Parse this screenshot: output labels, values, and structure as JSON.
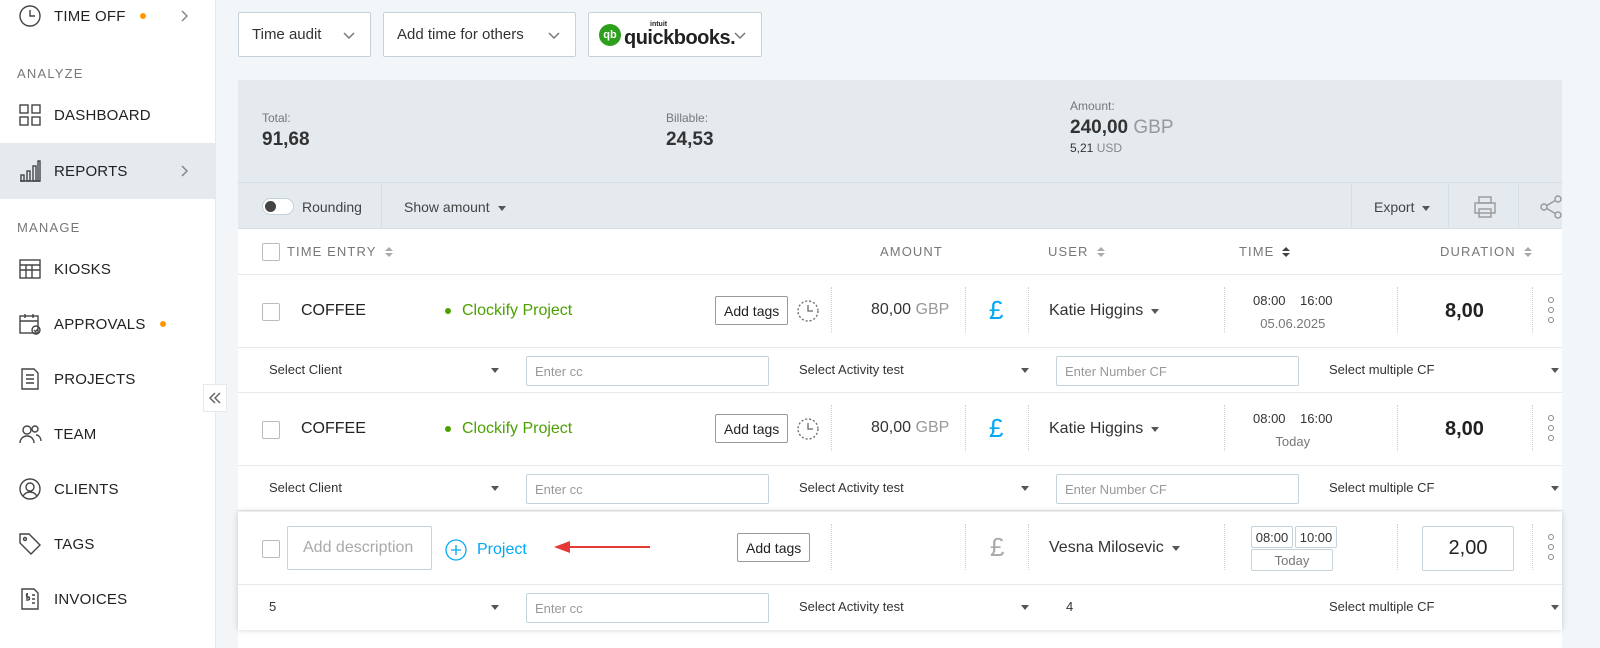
{
  "sidebar": {
    "items_top": [
      {
        "label": "TIME OFF",
        "icon": "clock-icon",
        "dot": true,
        "chevron": true
      }
    ],
    "section_analyze": "ANALYZE",
    "items_analyze": [
      {
        "label": "DASHBOARD",
        "icon": "dashboard-icon"
      },
      {
        "label": "REPORTS",
        "icon": "reports-icon",
        "chevron": true,
        "active": true
      }
    ],
    "section_manage": "MANAGE",
    "items_manage": [
      {
        "label": "KIOSKS",
        "icon": "kiosk-icon"
      },
      {
        "label": "APPROVALS",
        "icon": "approvals-icon",
        "dot": true
      },
      {
        "label": "PROJECTS",
        "icon": "projects-icon"
      },
      {
        "label": "TEAM",
        "icon": "team-icon"
      },
      {
        "label": "CLIENTS",
        "icon": "clients-icon"
      },
      {
        "label": "TAGS",
        "icon": "tag-icon"
      },
      {
        "label": "INVOICES",
        "icon": "invoice-icon"
      }
    ]
  },
  "top": {
    "time_audit": "Time audit",
    "add_time": "Add time for others",
    "qb_intuit": "intuit",
    "qb_name": "quickbooks.",
    "qb_mark": "qb"
  },
  "summary": {
    "total_label": "Total:",
    "total_value": "91,68",
    "billable_label": "Billable:",
    "billable_value": "24,53",
    "amount_label": "Amount:",
    "amount_value": "240,00",
    "amount_currency": "GBP",
    "amount_sub_value": "5,21",
    "amount_sub_currency": "USD"
  },
  "toolbar": {
    "rounding": "Rounding",
    "show_amount": "Show amount",
    "export": "Export"
  },
  "table": {
    "headers": {
      "time_entry": "TIME ENTRY",
      "amount": "AMOUNT",
      "user": "USER",
      "time": "TIME",
      "duration": "DURATION"
    },
    "rows": [
      {
        "description": "COFFEE",
        "project": "Clockify Project",
        "tags": "Add tags",
        "amount": "80,00",
        "currency": "GBP",
        "pound": "£",
        "user": "Katie Higgins",
        "start": "08:00",
        "end": "16:00",
        "date": "05.06.2025",
        "duration": "8,00",
        "cf": {
          "client": "Select Client",
          "cc": "Enter cc",
          "activity": "Select Activity test",
          "number": "Enter Number CF",
          "multiple": "Select multiple CF"
        }
      },
      {
        "description": "COFFEE",
        "project": "Clockify Project",
        "tags": "Add tags",
        "amount": "80,00",
        "currency": "GBP",
        "pound": "£",
        "user": "Katie Higgins",
        "start": "08:00",
        "end": "16:00",
        "date": "Today",
        "duration": "8,00",
        "cf": {
          "client": "Select Client",
          "cc": "Enter cc",
          "activity": "Select Activity test",
          "number": "Enter Number CF",
          "multiple": "Select multiple CF"
        }
      },
      {
        "description_placeholder": "Add description",
        "project": "Project",
        "tags": "Add tags",
        "pound": "£",
        "user": "Vesna Milosevic",
        "start": "08:00",
        "end": "10:00",
        "date": "Today",
        "duration": "2,00",
        "cf": {
          "client": "5",
          "cc": "Enter cc",
          "activity": "Select Activity test",
          "number": "4",
          "multiple": "Select multiple CF"
        }
      }
    ]
  },
  "colors": {
    "accent": "#03a9f4",
    "project_green": "#4ca100",
    "dot_orange": "#ff9800",
    "arrow_red": "#e53935"
  }
}
